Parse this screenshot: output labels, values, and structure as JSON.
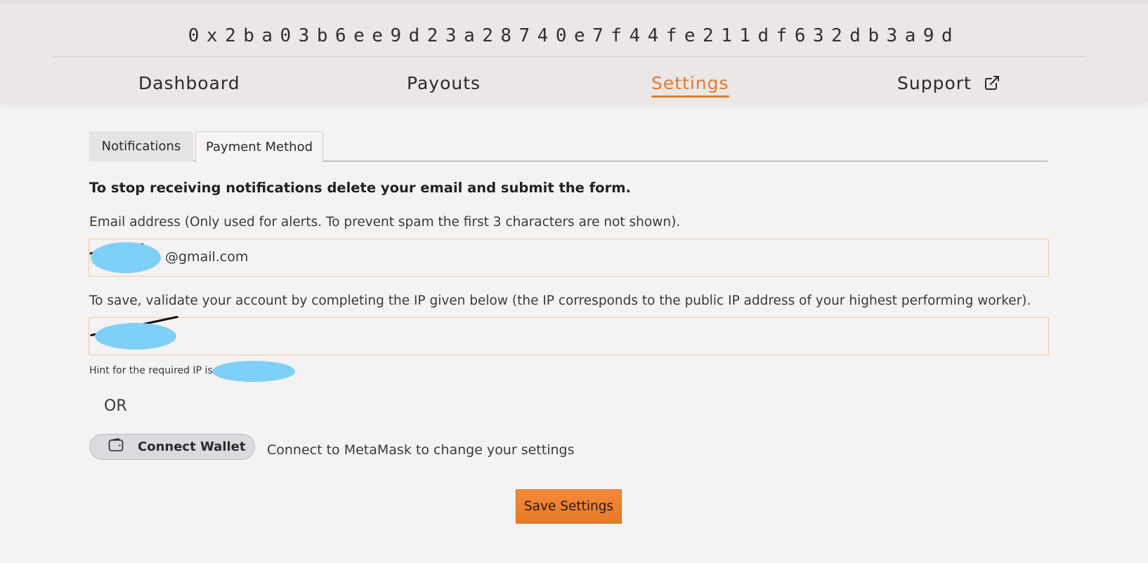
{
  "header": {
    "wallet_address": "0x2ba03b6ee9d23a28740e7f44fe211df632db3a9d",
    "nav": {
      "dashboard": "Dashboard",
      "payouts": "Payouts",
      "settings": "Settings",
      "support": "Support"
    },
    "active_nav": "Settings",
    "accent_color": "#e07b2c"
  },
  "tabs": {
    "notifications": "Notifications",
    "payment_method": "Payment Method"
  },
  "form": {
    "heading": "To stop receiving notifications delete your email and submit the form.",
    "email_label": "Email address (Only used for alerts. To prevent spam the first 3 characters are not shown).",
    "email_value": "@gmail.com",
    "ip_label": "To save, validate your account by completing the IP given below (the IP corresponds to the public IP address of your highest performing worker).",
    "ip_value": "",
    "hint": "Hint for the required IP is",
    "or": "OR",
    "connect_wallet": "Connect Wallet",
    "connect_desc": "Connect to MetaMask to change your settings",
    "save_button": "Save Settings"
  }
}
